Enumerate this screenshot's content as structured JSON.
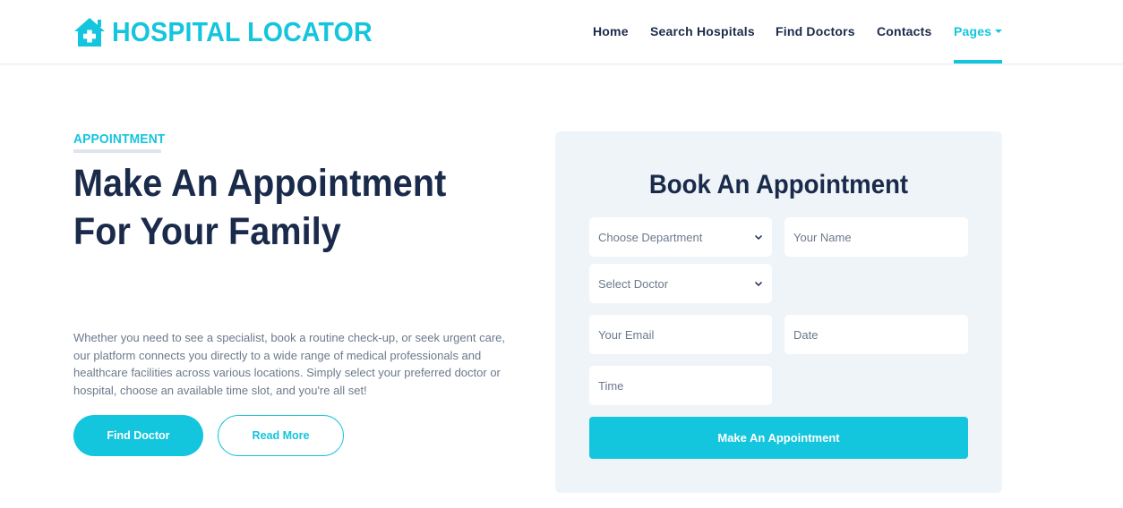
{
  "brand": {
    "name": "HOSPITAL LOCATOR",
    "icon": "hospital-house-icon",
    "color": "#13c5dd"
  },
  "nav": {
    "items": [
      {
        "label": "Home"
      },
      {
        "label": "Search Hospitals"
      },
      {
        "label": "Find Doctors"
      },
      {
        "label": "Contacts"
      },
      {
        "label": "Pages",
        "active": true
      }
    ]
  },
  "hero": {
    "eyebrow": "APPOINTMENT",
    "title": "Make An Appointment For Your Family",
    "description": "Whether you need to see a specialist, book a routine check-up, or seek urgent care, our platform connects you directly to a wide range of medical professionals and healthcare facilities across various locations. Simply select your preferred doctor or hospital, choose an available time slot, and you're all set!",
    "primary_button": "Find Doctor",
    "secondary_button": "Read More"
  },
  "form": {
    "title": "Book An Appointment",
    "department": {
      "selected": "Choose Department"
    },
    "doctor": {
      "selected": "Select Doctor"
    },
    "name_placeholder": "Your Name",
    "email_placeholder": "Your Email",
    "date_placeholder": "Date",
    "time_placeholder": "Time",
    "submit_label": "Make An Appointment"
  },
  "colors": {
    "accent": "#13c5dd",
    "heading": "#1a2a4a",
    "body_text": "#6b7a8c",
    "card_bg": "#eff4f8"
  }
}
